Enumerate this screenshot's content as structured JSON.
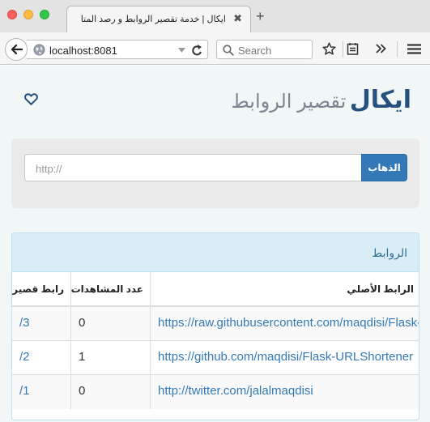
{
  "browser": {
    "tab_title": "ايكال | خدمة تقصير الروابط و رصد المتابعين",
    "tab_close": "✖",
    "new_tab": "+",
    "url": "localhost:8081",
    "search_placeholder": "Search"
  },
  "header": {
    "brand": "ايكال",
    "subtitle": "تقصير الروابط"
  },
  "shortener": {
    "placeholder": "http://",
    "submit_label": "الذهاب"
  },
  "links_panel": {
    "title": "الروابط",
    "columns": [
      "رابط قصير",
      "عدد المشاهدات",
      "الرابط الأصلي"
    ],
    "rows": [
      {
        "short": "/3",
        "views": "0",
        "original": "https://raw.githubusercontent.com/maqdisi/Flask-URLShortener"
      },
      {
        "short": "/2",
        "views": "1",
        "original": "https://github.com/maqdisi/Flask-URLShortener"
      },
      {
        "short": "/1",
        "views": "0",
        "original": "http://twitter.com/jalalmaqdisi"
      }
    ]
  },
  "colors": {
    "brand": "#26507d",
    "primary_button": "#3378b7",
    "panel_heading": "#d9edf7",
    "link": "#337ab7"
  },
  "icons": [
    "back-arrow-icon",
    "globe-icon",
    "reload-icon",
    "search-icon",
    "bookmark-star-icon",
    "reading-list-icon",
    "overflow-chevron-icon",
    "hamburger-menu-icon",
    "heart-icon"
  ]
}
